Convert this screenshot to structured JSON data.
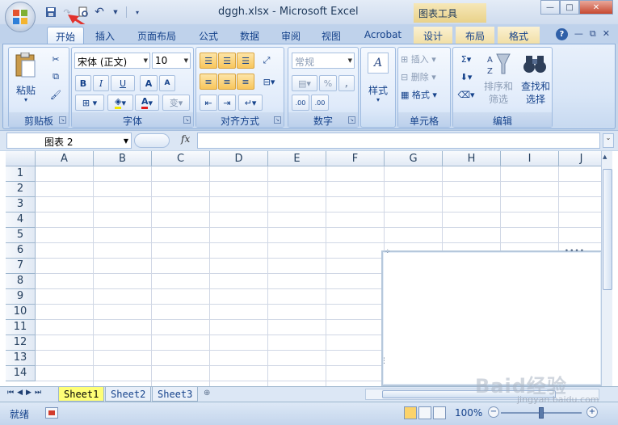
{
  "window": {
    "title": "dggh.xlsx - Microsoft Excel",
    "context_tab_group": "图表工具"
  },
  "tabs": [
    "开始",
    "插入",
    "页面布局",
    "公式",
    "数据",
    "审阅",
    "视图",
    "Acrobat",
    "设计",
    "布局",
    "格式"
  ],
  "ribbon": {
    "clipboard": {
      "paste": "粘贴",
      "label": "剪贴板"
    },
    "font": {
      "name": "宋体 (正文)",
      "size": "10",
      "bold": "B",
      "italic": "I",
      "underline": "U",
      "grow": "A",
      "shrink": "A",
      "font_color": "A",
      "phonetic": "变",
      "label": "字体"
    },
    "alignment": {
      "label": "对齐方式"
    },
    "number": {
      "format": "常规",
      "percent": "%",
      "comma": ",",
      "inc_decimal": ".00",
      "dec_decimal": ".00",
      "label": "数字"
    },
    "styles": {
      "label": "样式"
    },
    "cells": {
      "insert": "插入",
      "delete": "删除",
      "format": "格式",
      "label": "单元格"
    },
    "editing": {
      "sum": "Σ",
      "sort_filter": "排序和\n筛选",
      "find_select": "查找和\n选择",
      "label": "编辑"
    }
  },
  "formula_bar": {
    "name_box": "图表 2",
    "fx": "fx",
    "formula": ""
  },
  "grid": {
    "columns": [
      "A",
      "B",
      "C",
      "D",
      "E",
      "F",
      "G",
      "H",
      "I",
      "J"
    ],
    "rows": [
      "1",
      "2",
      "3",
      "4",
      "5",
      "6",
      "7",
      "8",
      "9",
      "10",
      "11",
      "12",
      "13",
      "14"
    ]
  },
  "sheets": [
    "Sheet1",
    "Sheet2",
    "Sheet3"
  ],
  "status": {
    "ready": "就绪",
    "zoom": "100%"
  },
  "watermark": {
    "main": "Baid经验",
    "sub": "jingyan.baidu.com"
  },
  "colors": {
    "accent": "#15428b",
    "ribbon_bg": "#dfeafa",
    "active_sheet": "#ffff77",
    "context_tab": "#f1dfa6"
  }
}
